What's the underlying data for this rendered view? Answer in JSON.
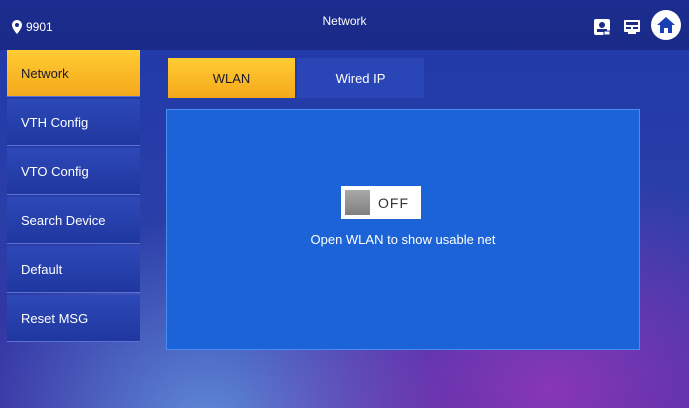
{
  "header": {
    "location_id": "9901",
    "title": "Network",
    "icons": [
      "location-pin-icon",
      "user-card-icon",
      "monitor-icon",
      "home-icon"
    ]
  },
  "sidebar": {
    "items": [
      {
        "label": "Network",
        "active": true
      },
      {
        "label": "VTH Config",
        "active": false
      },
      {
        "label": "VTO Config",
        "active": false
      },
      {
        "label": "Search Device",
        "active": false
      },
      {
        "label": "Default",
        "active": false
      },
      {
        "label": "Reset MSG",
        "active": false
      }
    ]
  },
  "tabs": [
    {
      "label": "WLAN",
      "active": true
    },
    {
      "label": "Wired IP",
      "active": false
    }
  ],
  "wlan": {
    "toggle_state": "OFF",
    "hint": "Open WLAN to show usable net"
  },
  "colors": {
    "accent": "#f4a81b",
    "panel": "#1b63d6",
    "topbar": "#1a2a86"
  }
}
